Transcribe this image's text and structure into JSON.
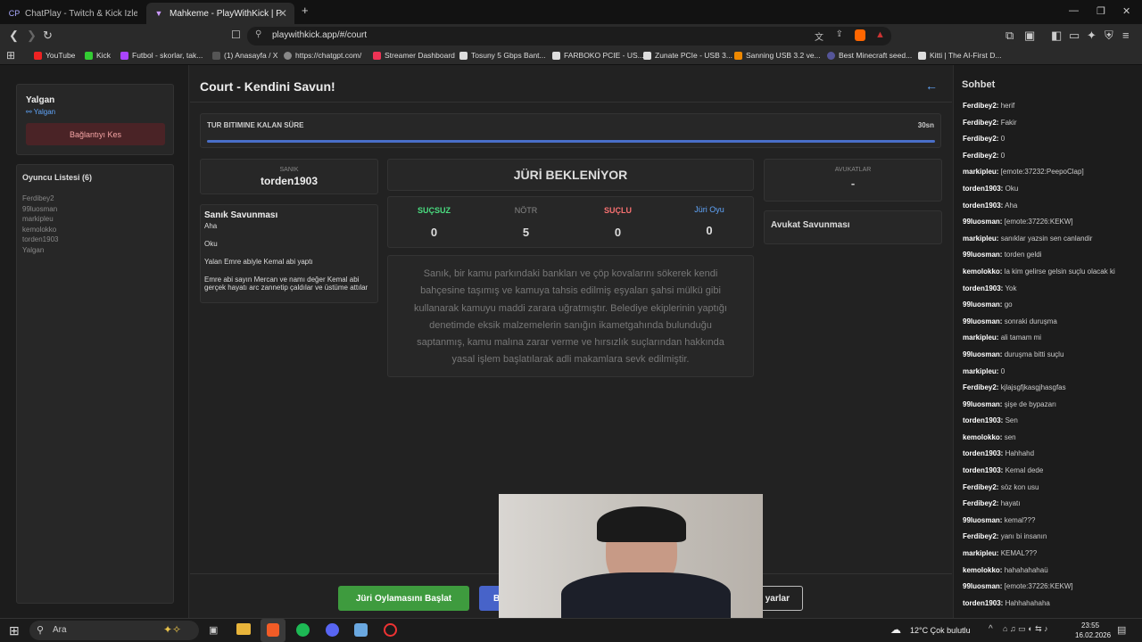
{
  "browser": {
    "tabs": [
      {
        "label": "ChatPlay - Twitch & Kick İzleyici Etkile",
        "icon": "CP"
      },
      {
        "label": "Mahkeme - PlayWithKick | PlayW",
        "icon": "▼"
      }
    ],
    "url": "playwithkick.app/#/court",
    "bookmarks": [
      {
        "label": "YouTube",
        "color": "#e22"
      },
      {
        "label": "Kick",
        "color": "#3c3"
      },
      {
        "label": "Futbol - skorlar, tak...",
        "color": "#a4f"
      },
      {
        "label": "(1) Anasayfa / X",
        "color": "#ddd"
      },
      {
        "label": "https://chatgpt.com/",
        "color": "#ccc"
      },
      {
        "label": "Streamer Dashboard",
        "color": "#e35"
      },
      {
        "label": "Tosuny 5 Gbps Bant...",
        "color": "#ddd"
      },
      {
        "label": "FARBOKO PCIE - US...",
        "color": "#ddd"
      },
      {
        "label": "Zunate PCIe - USB 3...",
        "color": "#ddd"
      },
      {
        "label": "Sanning USB 3.2 ve...",
        "color": "#e80"
      },
      {
        "label": "Best Minecraft seed...",
        "color": "#559"
      },
      {
        "label": "Kitti | The AI-First D...",
        "color": "#ddd"
      }
    ]
  },
  "user": {
    "name": "Yalgan",
    "link": "Yalgan",
    "disconnect": "Bağlantıyı Kes"
  },
  "players": {
    "title": "Oyuncu Listesi (6)",
    "list": [
      "Ferdibey2",
      "99luosman",
      "markipleu",
      "kemolokko",
      "torden1903",
      "Yalgan"
    ]
  },
  "page": {
    "title": "Court - Kendini Savun!",
    "back_icon": "←"
  },
  "timer": {
    "label": "TUR BITIMINE KALAN SÜRE",
    "value": "30sn",
    "progress": 1.0
  },
  "defendant": {
    "label": "SANIK",
    "name": "torden1903"
  },
  "defense": {
    "title": "Sanık Savunması",
    "lines": [
      "Aha",
      "Oku",
      "Yalan Emre abiyle Kemal abi yaptı",
      "Emre abi sayın Mercan ve namı değer Kemal abi gerçek hayatı arc zannetip çaldılar ve üstüme attılar"
    ]
  },
  "jury": {
    "status": "JÜRİ BEKLENİYOR",
    "votes": [
      {
        "label": "SUÇSUZ",
        "value": "0",
        "color": "#4ade80"
      },
      {
        "label": "NÖTR",
        "value": "5",
        "color": "#888888"
      },
      {
        "label": "SUÇLU",
        "value": "0",
        "color": "#f87171"
      },
      {
        "label": "Jüri Oyu",
        "value": "0",
        "color": "#60a5fa"
      }
    ]
  },
  "accusation": "Sanık, bir kamu parkındaki bankları ve çöp kovalarını sökerek kendi bahçesine taşımış ve kamuya tahsis edilmiş eşyaları şahsi mülkü gibi kullanarak kamuyu maddi zarara uğratmıştır. Belediye ekiplerinin yaptığı denetimde eksik malzemelerin sanığın ikametgahında bulunduğu saptanmış, kamu malına zarar verme ve hırsızlık suçlarından hakkında yasal işlem başlatılarak adli makamlara sevk edilmiştir.",
  "lawyers": {
    "label": "AVUKATLAR",
    "value": "-",
    "defense_title": "Avukat Savunması"
  },
  "actions": {
    "start_vote": "Jüri Oylamasını Başlat",
    "second": "B",
    "third": "yarlar"
  },
  "chat": {
    "title": "Sohbet",
    "messages": [
      {
        "user": "Ferdibey2:",
        "text": "herif"
      },
      {
        "user": "Ferdibey2:",
        "text": "Fakir"
      },
      {
        "user": "Ferdibey2:",
        "text": "0"
      },
      {
        "user": "Ferdibey2:",
        "text": "0"
      },
      {
        "user": "markipleu:",
        "text": "[emote:37232:PeepoClap]"
      },
      {
        "user": "torden1903:",
        "text": "Oku"
      },
      {
        "user": "torden1903:",
        "text": "Aha"
      },
      {
        "user": "99luosman:",
        "text": "[emote:37226:KEKW]"
      },
      {
        "user": "markipleu:",
        "text": "sanıklar yazsin sen canlandir"
      },
      {
        "user": "99luosman:",
        "text": "torden geldi"
      },
      {
        "user": "kemolokko:",
        "text": "la kim gelirse gelsin suçlu olacak ki"
      },
      {
        "user": "torden1903:",
        "text": "Yok"
      },
      {
        "user": "99luosman:",
        "text": "go"
      },
      {
        "user": "99luosman:",
        "text": "sonraki duruşma"
      },
      {
        "user": "markipleu:",
        "text": "ali tamam mi"
      },
      {
        "user": "99luosman:",
        "text": "duruşma bitti suçlu"
      },
      {
        "user": "markipleu:",
        "text": "0"
      },
      {
        "user": "Ferdibey2:",
        "text": "kjlajsgfjkasgjhasgfas"
      },
      {
        "user": "99luosman:",
        "text": "şişe de bypazarı"
      },
      {
        "user": "torden1903:",
        "text": "Sen"
      },
      {
        "user": "kemolokko:",
        "text": "sen"
      },
      {
        "user": "torden1903:",
        "text": "Hahhahd"
      },
      {
        "user": "torden1903:",
        "text": "Kemal dede"
      },
      {
        "user": "Ferdibey2:",
        "text": "söz kon usu"
      },
      {
        "user": "Ferdibey2:",
        "text": "hayatı"
      },
      {
        "user": "99luosman:",
        "text": "kemal???"
      },
      {
        "user": "Ferdibey2:",
        "text": "yanı bi insanın"
      },
      {
        "user": "markipleu:",
        "text": "KEMAL???"
      },
      {
        "user": "kemolokko:",
        "text": "hahahahahaü"
      },
      {
        "user": "99luosman:",
        "text": "[emote:37226:KEKW]"
      },
      {
        "user": "torden1903:",
        "text": "Hahhahahaha"
      }
    ]
  },
  "taskbar": {
    "search": "Ara",
    "weather": "12°C  Çok bulutlu",
    "time": "23:55",
    "date": "16.02.2026"
  }
}
